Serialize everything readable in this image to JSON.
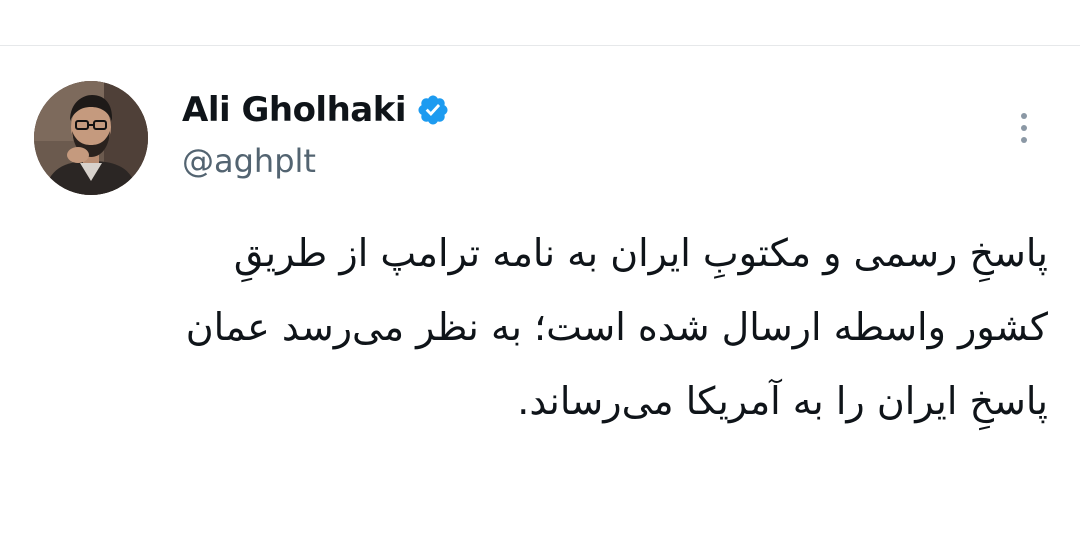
{
  "author": {
    "name": "Ali Gholhaki",
    "handle": "@aghplt",
    "verified": true,
    "verified_badge_color": "#1d9bf0"
  },
  "tweet": {
    "text_lines": [
      "پاسخِ رسمی و مکتوبِ ایران به نامه ترامپ از طریقِ",
      "کشور واسطه ارسال شده است؛ به نظر می‌رسد عمان",
      "پاسخِ ایران را به آمریکا می‌رساند."
    ]
  },
  "icons": {
    "verified": "verified-badge-icon",
    "more": "more-vertical-icon"
  },
  "colors": {
    "text_primary": "#0f1419",
    "text_secondary": "#536471",
    "divider": "#e6e8ea",
    "background": "#ffffff"
  }
}
